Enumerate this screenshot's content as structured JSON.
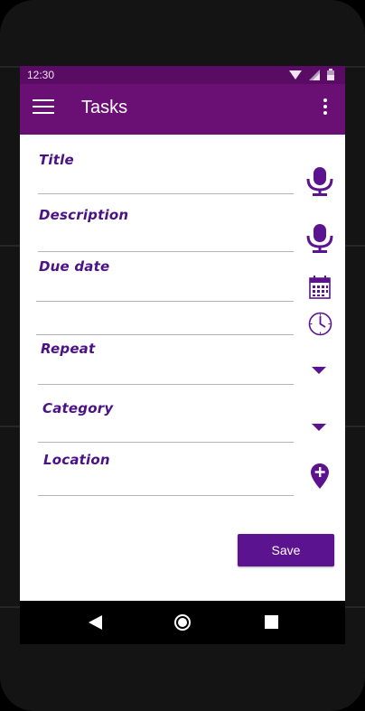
{
  "status_bar": {
    "time": "12:30"
  },
  "app_bar": {
    "title": "Tasks",
    "menu_icon": "hamburger-menu-icon",
    "more_icon": "more-vertical-icon"
  },
  "form": {
    "title_label": "Title",
    "description_label": "Description",
    "due_date_label": "Due date",
    "repeat_label": "Repeat",
    "category_label": "Category",
    "location_label": "Location"
  },
  "actions": {
    "save_label": "Save"
  },
  "colors": {
    "status_bar": "#5a0c64",
    "app_bar": "#6a0f74",
    "accent": "#5c138f",
    "label": "#4b1286",
    "icon": "#5c138f"
  },
  "icons": [
    "microphone-icon",
    "calendar-icon",
    "clock-icon",
    "dropdown-arrow-icon",
    "location-add-icon"
  ]
}
